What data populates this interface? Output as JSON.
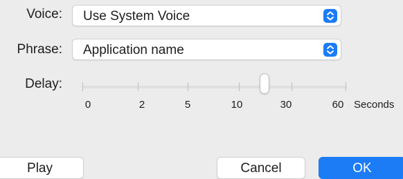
{
  "voice": {
    "label": "Voice:",
    "value": "Use System Voice"
  },
  "phrase": {
    "label": "Phrase:",
    "value": "Application name"
  },
  "delay": {
    "label": "Delay:",
    "ticks": [
      "0",
      "2",
      "5",
      "10",
      "30",
      "60"
    ],
    "units": "Seconds",
    "value_seconds": 20
  },
  "buttons": {
    "play": "Play",
    "cancel": "Cancel",
    "ok": "OK"
  },
  "colors": {
    "accent": "#1b7cf5",
    "background": "#ececec"
  }
}
